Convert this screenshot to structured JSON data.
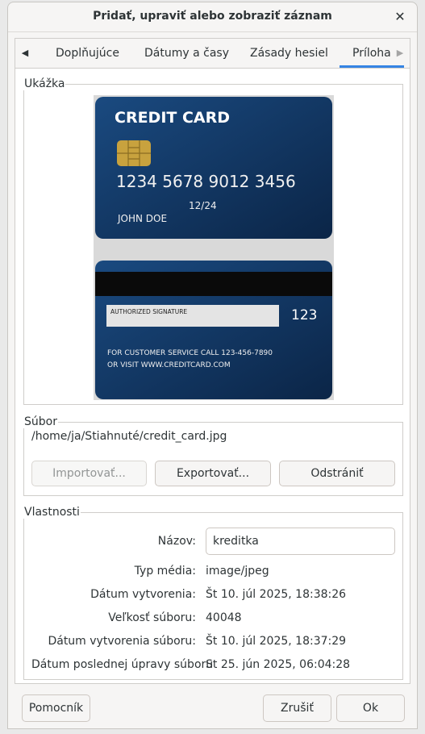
{
  "window": {
    "title": "Pridať, upraviť alebo zobraziť záznam",
    "close_glyph": "✕"
  },
  "tabs": {
    "items": [
      "Doplňujúce",
      "Dátumy a časy",
      "Zásady hesiel",
      "Príloha"
    ],
    "active": "Príloha",
    "left_arrow": "◀",
    "right_arrow": "▶"
  },
  "preview": {
    "legend": "Ukážka",
    "card_front": {
      "heading": "CREDIT CARD",
      "number": "1234 5678 9012 3456",
      "expiry": "12/24",
      "holder": "JOHN DOE"
    },
    "card_back": {
      "signature_label": "AUTHORIZED SIGNATURE",
      "cvv": "123",
      "service_line1": "FOR CUSTOMER SERVICE CALL 123-456-7890",
      "service_line2": "OR VISIT WWW.CREDITCARD.COM"
    },
    "colors": {
      "card": "#123a6b",
      "card_dark": "#0b2547",
      "chip": "#c8a23e"
    }
  },
  "file": {
    "legend": "Súbor",
    "path": "/home/ja/Stiahnuté/credit_card.jpg",
    "import_label": "Importovať...",
    "export_label": "Exportovať...",
    "remove_label": "Odstrániť"
  },
  "properties": {
    "legend": "Vlastnosti",
    "name_label": "Názov:",
    "name_value": "kreditka",
    "rows": [
      {
        "label": "Typ média:",
        "value": "image/jpeg"
      },
      {
        "label": "Dátum vytvorenia:",
        "value": "Št 10. júl 2025, 18:38:26"
      },
      {
        "label": "Veľkosť súboru:",
        "value": "40048"
      },
      {
        "label": "Dátum vytvorenia súboru:",
        "value": "Št 10. júl 2025, 18:37:29"
      },
      {
        "label": "Dátum poslednej úpravy súboru",
        "value": "St 25. jún 2025, 06:04:28"
      }
    ]
  },
  "footer": {
    "help_label": "Pomocník",
    "cancel_label": "Zrušiť",
    "ok_label": "Ok"
  },
  "colors": {
    "accent": "#3584e4"
  }
}
